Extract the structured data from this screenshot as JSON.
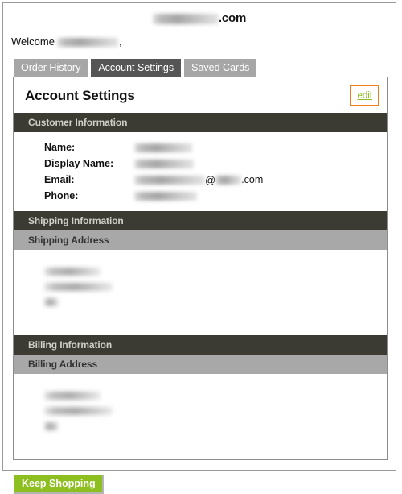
{
  "site": {
    "name_redacted": true,
    "tld": ".com"
  },
  "welcome": {
    "prefix": "Welcome",
    "name_redacted": true,
    "suffix": ","
  },
  "tabs": [
    {
      "label": "Order History",
      "active": false
    },
    {
      "label": "Account Settings",
      "active": true
    },
    {
      "label": "Saved Cards",
      "active": false
    }
  ],
  "panel": {
    "title": "Account Settings",
    "edit_label": "edit"
  },
  "sections": {
    "customer": {
      "heading": "Customer Information",
      "rows": [
        {
          "label": "Name:",
          "value_redacted": true
        },
        {
          "label": "Display Name:",
          "value_redacted": true
        },
        {
          "label": "Email:",
          "value_at": "@",
          "value_tld": ".com"
        },
        {
          "label": "Phone:",
          "value_redacted": true
        }
      ]
    },
    "shipping": {
      "heading": "Shipping Information",
      "subheading": "Shipping Address",
      "address_lines_redacted": 3
    },
    "billing": {
      "heading": "Billing Information",
      "subheading": "Billing Address",
      "address_lines_redacted": 3
    }
  },
  "footer": {
    "keep_shopping_label": "Keep Shopping"
  },
  "colors": {
    "section_header_bg": "#3b3b33",
    "subheader_bg": "#a8a8a8",
    "tab_inactive_bg": "#a6a6a6",
    "tab_active_bg": "#555555",
    "edit_border": "#f07d1e",
    "edit_text": "#8cbf26",
    "button_green": "#8cbf1f"
  }
}
